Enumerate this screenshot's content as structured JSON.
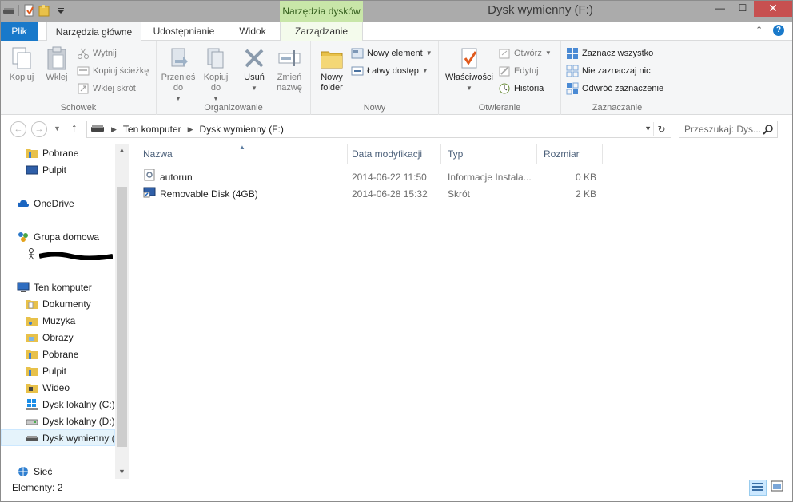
{
  "window": {
    "title": "Dysk wymienny (F:)",
    "contextual_tab": "Narzędzia dysków",
    "controls": {
      "minimize": "—",
      "maximize": "☐",
      "close": "✕"
    }
  },
  "tabs": {
    "file": "Plik",
    "home": "Narzędzia główne",
    "share": "Udostępnianie",
    "view": "Widok",
    "manage": "Zarządzanie",
    "collapse": "⌃",
    "help": "?"
  },
  "ribbon": {
    "clipboard": {
      "label": "Schowek",
      "copy": "Kopiuj",
      "paste": "Wklej",
      "cut": "Wytnij",
      "copy_path": "Kopiuj ścieżkę",
      "paste_shortcut": "Wklej skrót"
    },
    "organize": {
      "label": "Organizowanie",
      "move_to": "Przenieś do",
      "copy_to": "Kopiuj do",
      "delete": "Usuń",
      "rename": "Zmień nazwę"
    },
    "new": {
      "label": "Nowy",
      "new_folder": "Nowy folder",
      "new_item": "Nowy element",
      "easy_access": "Łatwy dostęp"
    },
    "open": {
      "label": "Otwieranie",
      "properties": "Właściwości",
      "open": "Otwórz",
      "edit": "Edytuj",
      "history": "Historia"
    },
    "select": {
      "label": "Zaznaczanie",
      "select_all": "Zaznacz wszystko",
      "select_none": "Nie zaznaczaj nic",
      "invert": "Odwróć zaznaczenie"
    }
  },
  "address": {
    "crumbs": [
      "Ten komputer",
      "Dysk wymienny (F:)"
    ],
    "search_placeholder": "Przeszukaj: Dys..."
  },
  "navpane": {
    "items": [
      {
        "label": "Pobrane",
        "icon": "folder-icon"
      },
      {
        "label": "Pulpit",
        "icon": "desktop-icon"
      },
      {
        "label": "OneDrive",
        "icon": "cloud-icon"
      },
      {
        "label": "Grupa domowa",
        "icon": "homegroup-icon"
      },
      {
        "label": "Ten komputer",
        "icon": "computer-icon"
      },
      {
        "label": "Dokumenty",
        "icon": "folder-icon"
      },
      {
        "label": "Muzyka",
        "icon": "folder-icon"
      },
      {
        "label": "Obrazy",
        "icon": "folder-icon"
      },
      {
        "label": "Pobrane",
        "icon": "folder-icon"
      },
      {
        "label": "Pulpit",
        "icon": "folder-icon"
      },
      {
        "label": "Wideo",
        "icon": "folder-icon"
      },
      {
        "label": "Dysk lokalny (C:)",
        "icon": "windows-drive-icon"
      },
      {
        "label": "Dysk lokalny (D:)",
        "icon": "drive-icon"
      },
      {
        "label": "Dysk wymienny (F:)",
        "icon": "removable-drive-icon"
      },
      {
        "label": "Sieć",
        "icon": "network-icon"
      }
    ]
  },
  "files": {
    "columns": [
      "Nazwa",
      "Data modyfikacji",
      "Typ",
      "Rozmiar"
    ],
    "rows": [
      {
        "name": "autorun",
        "date": "2014-06-22 11:50",
        "type": "Informacje Instala...",
        "size": "0 KB",
        "icon": "setup-info-icon"
      },
      {
        "name": "Removable Disk (4GB)",
        "date": "2014-06-28 15:32",
        "type": "Skrót",
        "size": "2 KB",
        "icon": "shortcut-icon"
      }
    ]
  },
  "status": {
    "items_count": "Elementy: 2"
  },
  "colors": {
    "accent": "#1979ca",
    "contextual": "#c8e6a8",
    "close": "#c75050"
  }
}
